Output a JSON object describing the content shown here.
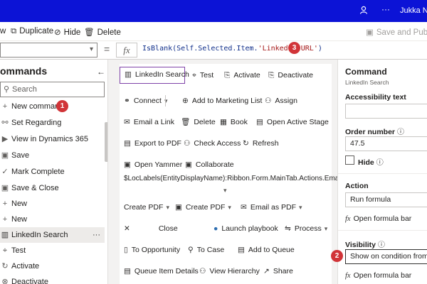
{
  "topbar": {
    "user_name": "Jukka Niira",
    "icons": [
      "people-icon",
      "ellipsis-icon"
    ]
  },
  "commandbar": {
    "items": [
      {
        "label": "w",
        "icon": ""
      },
      {
        "label": "Duplicate",
        "icon": "duplicate-icon"
      },
      {
        "label": "Hide",
        "icon": "hide-icon"
      },
      {
        "label": "Delete",
        "icon": "delete-icon"
      }
    ],
    "save_publish": "Save and Publish"
  },
  "formulabar": {
    "property": "",
    "equals": "=",
    "fx": "fx",
    "formula_prefix": "IsBlank(Self.Selected.Item.",
    "formula_string": "'LinkedIn URL'",
    "formula_suffix": ")"
  },
  "badges": {
    "one": "1",
    "two": "2",
    "three": "3"
  },
  "leftpane": {
    "title": "ommands",
    "search_placeholder": "Search",
    "items": [
      {
        "label": "New command",
        "icon": "plus-icon"
      },
      {
        "label": "Set Regarding",
        "icon": "link-icon"
      },
      {
        "label": "View in Dynamics 365",
        "icon": "dynamics-icon"
      },
      {
        "label": "Save",
        "icon": "save-icon"
      },
      {
        "label": "Mark Complete",
        "icon": "check-icon"
      },
      {
        "label": "Save & Close",
        "icon": "save-close-icon"
      },
      {
        "label": "New",
        "icon": "plus-icon"
      },
      {
        "label": "New",
        "icon": "plus-icon"
      },
      {
        "label": "LinkedIn Search",
        "icon": "linkedin-icon",
        "selected": true
      },
      {
        "label": "Test",
        "icon": "test-icon"
      },
      {
        "label": "Activate",
        "icon": "activate-icon"
      },
      {
        "label": "Deactivate",
        "icon": "deactivate-icon"
      }
    ],
    "more": "···"
  },
  "canvas": {
    "buttons": [
      {
        "label": "LinkedIn Search",
        "icon": "linkedin-icon"
      },
      {
        "label": "Test",
        "icon": "test-icon"
      },
      {
        "label": "Activate",
        "icon": "activate-icon"
      },
      {
        "label": "Deactivate",
        "icon": "deactivate-icon"
      },
      {
        "label": "Connect",
        "icon": "connect-icon"
      },
      {
        "label": "Add to Marketing List",
        "icon": "marketing-list-icon"
      },
      {
        "label": "Assign",
        "icon": "assign-icon"
      },
      {
        "label": "Email a Link",
        "icon": "email-link-icon"
      },
      {
        "label": "Delete",
        "icon": "delete-icon"
      },
      {
        "label": "Book",
        "icon": "book-icon"
      },
      {
        "label": "Open Active Stage",
        "icon": "stage-icon"
      },
      {
        "label": "Export to PDF",
        "icon": "pdf-icon"
      },
      {
        "label": "Check Access",
        "icon": "check-access-icon"
      },
      {
        "label": "Refresh",
        "icon": "refresh-icon"
      },
      {
        "label": "Open Yammer",
        "icon": "yammer-icon"
      },
      {
        "label": "Collaborate",
        "icon": "collaborate-icon"
      },
      {
        "label": "Create PDF",
        "icon": ""
      },
      {
        "label": "Create PDF",
        "icon": "pdf-icon"
      },
      {
        "label": "Email as PDF",
        "icon": "email-pdf-icon"
      },
      {
        "label": "Close",
        "icon": "close-icon"
      },
      {
        "label": "Launch playbook",
        "icon": "playbook-icon"
      },
      {
        "label": "Process",
        "icon": "process-icon"
      },
      {
        "label": "To Opportunity",
        "icon": "opportunity-icon"
      },
      {
        "label": "To Case",
        "icon": "case-icon"
      },
      {
        "label": "Add to Queue",
        "icon": "queue-icon"
      },
      {
        "label": "Queue Item Details",
        "icon": "queue-details-icon"
      },
      {
        "label": "View Hierarchy",
        "icon": "hierarchy-icon"
      },
      {
        "label": "Share",
        "icon": "share-icon"
      }
    ],
    "long_label": "$LocLabels(EntityDisplayName):Ribbon.Form.MainTab.Actions.EmailAsPDF"
  },
  "rightpane": {
    "title": "Command",
    "subtitle": "LinkedIn Search",
    "accessibility_label": "Accessibility text",
    "accessibility_value": "",
    "order_label": "Order number",
    "order_value": "47.5",
    "hide_label": "Hide",
    "action_label": "Action",
    "action_value": "Run formula",
    "open_formula_bar": "Open formula bar",
    "visibility_label": "Visibility",
    "visibility_value": "Show on condition from for...",
    "open_formula_bar_2": "Open formula bar"
  }
}
